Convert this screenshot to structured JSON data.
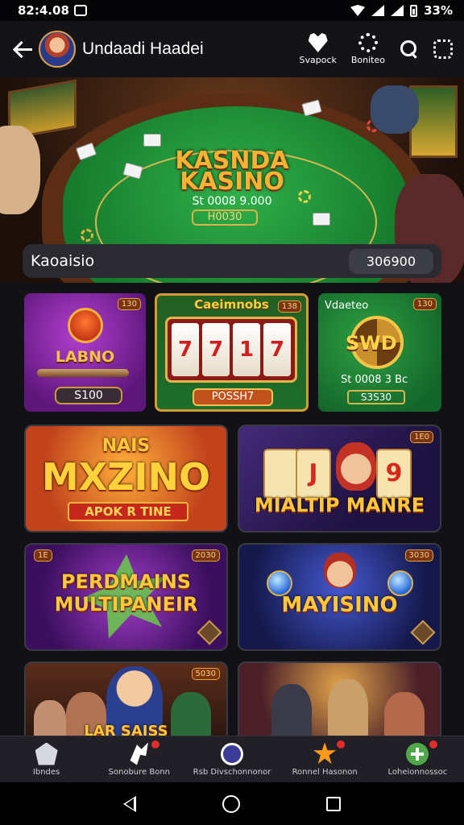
{
  "status": {
    "time": "82:4.08",
    "battery": "33%"
  },
  "appbar": {
    "title": "Undaadi Haadei",
    "actions": [
      {
        "label": "Svapock",
        "icon": "heart-icon"
      },
      {
        "label": "Boniteo",
        "icon": "chip-icon"
      }
    ]
  },
  "hero": {
    "title1": "KASNDA",
    "title2": "KASINO",
    "value": "St 0008 9.000",
    "pill": "H0030"
  },
  "searchrow": {
    "label": "Kaoaisio",
    "amount": "306900"
  },
  "tiles": [
    {
      "badge": "130",
      "name": "LABNO",
      "button": "S100"
    },
    {
      "badge": "138",
      "name": "Caeimnobs",
      "reels": [
        "7",
        "7",
        "1",
        "7"
      ],
      "button": "POSSH7"
    },
    {
      "badge": "130",
      "subtitle": "Vdaeteo",
      "name": "SWD",
      "value": "St 0008 3 Bc",
      "button": "S3S30"
    }
  ],
  "bigtiles": [
    {
      "badge": "",
      "top": "NAIS",
      "title": "MXZINO",
      "ribbon": "APOK R TINE"
    },
    {
      "badge": "1E0",
      "cards": [
        "J",
        "9"
      ],
      "title": "MIALTIP MANRE"
    },
    {
      "badge_left": "1E",
      "badge": "2030",
      "title1": "PERDMAINS",
      "title2": "MULTIPANEIR"
    },
    {
      "badge": "3030",
      "title": "MAYISINO"
    },
    {
      "badge": "5030",
      "title": "LAR SAISS"
    },
    {
      "badge": ""
    }
  ],
  "bottomnav": [
    {
      "label": "Ibndes",
      "icon": "home-icon",
      "dot": false
    },
    {
      "label": "Sonobure Bonn",
      "icon": "sports-icon",
      "dot": true
    },
    {
      "label": "Rsb Divschonnonor",
      "icon": "check-icon",
      "dot": false
    },
    {
      "label": "Ronnel Hasonon",
      "icon": "star-icon",
      "dot": true
    },
    {
      "label": "Loheionnossoc",
      "icon": "plus-icon",
      "dot": true
    }
  ]
}
